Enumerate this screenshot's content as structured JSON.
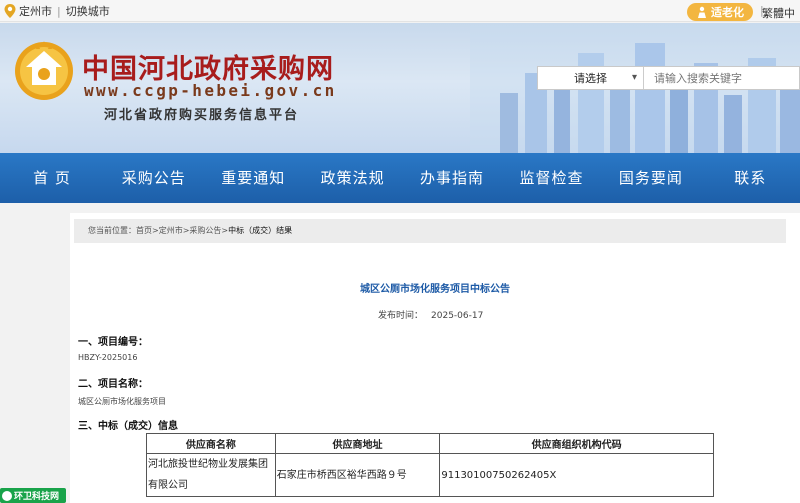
{
  "topbar": {
    "city": "定州市",
    "divider": "|",
    "switch_city": "切换城市",
    "elder_mode": "适老化",
    "trad_divider": "|",
    "traditional": "繁體中"
  },
  "header": {
    "title": "中国河北政府采购网",
    "url": "www.ccgp-hebei.gov.cn",
    "subtitle": "河北省政府购买服务信息平台"
  },
  "search": {
    "select_value": "请选择",
    "placeholder": "请输入搜索关键字"
  },
  "nav": [
    "首 页",
    "采购公告",
    "重要通知",
    "政策法规",
    "办事指南",
    "监督检查",
    "国务要闻",
    "联系"
  ],
  "breadcrumb": {
    "label": "您当前位置：",
    "path": "首页>定州市>采购公告>",
    "current": "中标（成交）结果"
  },
  "announcement": {
    "title": "城区公厕市场化服务项目中标公告",
    "publish_label": "发布时间：",
    "publish_date": "2025-06-17",
    "section1_heading": "一、项目编号：",
    "project_number": "HBZY-2025016",
    "section2_heading": "二、项目名称：",
    "project_name": "城区公厕市场化服务项目",
    "section3_heading": "三、中标（成交）信息"
  },
  "supplier_table": {
    "headers": [
      "供应商名称",
      "供应商地址",
      "供应商组织机构代码"
    ],
    "rows": [
      {
        "name_line1": "河北旅投世纪物业发展集团",
        "name_line2": "有限公司",
        "address": "石家庄市桥西区裕华西路９号",
        "code": "91130100750262405X"
      }
    ]
  },
  "badge": {
    "label": "环卫科技网"
  },
  "colors": {
    "nav_bg": "#1d5fa9",
    "title_red": "#a81c1c",
    "accent_gold": "#f3b640",
    "link_blue": "#1d5aa6",
    "badge_green": "#19a34a"
  }
}
